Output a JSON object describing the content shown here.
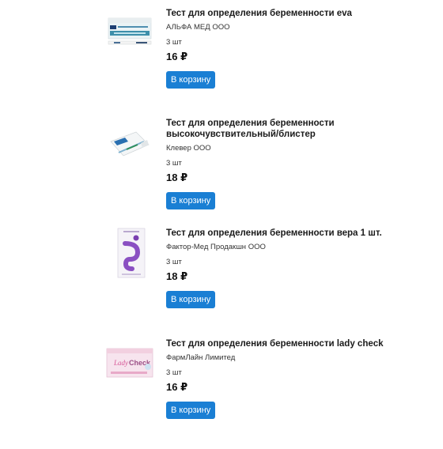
{
  "products": [
    {
      "title": "Тест для определения беременности eva",
      "maker": "АЛЬФА МЕД ООО",
      "qty": "3 шт",
      "price": "16 ₽",
      "button": "В корзину",
      "image": "pregnancy-test-strip-box-icon"
    },
    {
      "title": "Тест для определения беременности высокочувствительный/блистер",
      "maker": "Клевер ООО",
      "qty": "3 шт",
      "price": "18 ₽",
      "button": "В корзину",
      "image": "pregnancy-test-blister-icon"
    },
    {
      "title": "Тест для определения беременности вера 1 шт.",
      "maker": "Фактор-Мед Продакшн ООО",
      "qty": "3 шт",
      "price": "18 ₽",
      "button": "В корзину",
      "image": "vera-test-package-icon"
    },
    {
      "title": "Тест для определения беременности lady check",
      "maker": "ФармЛайн Лимитед",
      "qty": "3 шт",
      "price": "16 ₽",
      "button": "В корзину",
      "image": "lady-check-package-icon",
      "logo_text": "Lady Check"
    }
  ]
}
